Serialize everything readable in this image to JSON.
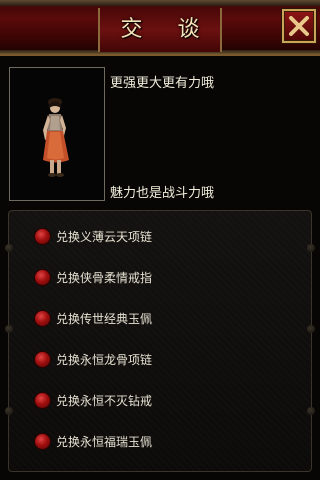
{
  "header": {
    "title": "交 谈",
    "close_icon": "close-x-icon"
  },
  "dialog": {
    "npc_portrait": "npc-character-portrait",
    "line1": "更强更大更有力哦",
    "line2": "魅力也是战斗力哦"
  },
  "options": [
    {
      "label": "兑换义薄云天项链",
      "icon": "red-orb-icon"
    },
    {
      "label": "兑换侠骨柔情戒指",
      "icon": "red-orb-icon"
    },
    {
      "label": "兑换传世经典玉佩",
      "icon": "red-orb-icon"
    },
    {
      "label": "兑换永恒龙骨项链",
      "icon": "red-orb-icon"
    },
    {
      "label": "兑换永恒不灭钻戒",
      "icon": "red-orb-icon"
    },
    {
      "label": "兑换永恒福瑞玉佩",
      "icon": "red-orb-icon"
    }
  ],
  "colors": {
    "header_red": "#5a0b0b",
    "gold_trim": "#c9a45a",
    "text": "#f2eedc",
    "orb_red": "#a10f0f"
  }
}
